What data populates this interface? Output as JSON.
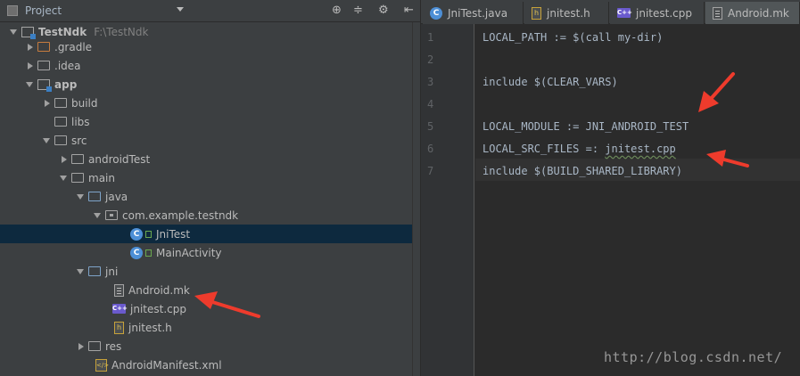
{
  "project_panel": {
    "title": "Project"
  },
  "tree": [
    {
      "label": "TestNdk",
      "path": "F:\\TestNdk"
    },
    {
      "label": ".gradle"
    },
    {
      "label": ".idea"
    },
    {
      "label": "app"
    },
    {
      "label": "build"
    },
    {
      "label": "libs"
    },
    {
      "label": "src"
    },
    {
      "label": "androidTest"
    },
    {
      "label": "main"
    },
    {
      "label": "java"
    },
    {
      "label": "com.example.testndk"
    },
    {
      "label": "JniTest",
      "badge": "C"
    },
    {
      "label": "MainActivity",
      "badge": "C"
    },
    {
      "label": "jni"
    },
    {
      "label": "Android.mk"
    },
    {
      "label": "jnitest.cpp",
      "badge": "C++"
    },
    {
      "label": "jnitest.h",
      "badge": "h"
    },
    {
      "label": "res"
    },
    {
      "label": "AndroidManifest.xml"
    }
  ],
  "tabs": [
    {
      "label": "JniTest.java",
      "badge": "C"
    },
    {
      "label": "jnitest.h",
      "badge": "h"
    },
    {
      "label": "jnitest.cpp",
      "badge": "C++"
    },
    {
      "label": "Android.mk"
    }
  ],
  "editor": {
    "lines": [
      {
        "num": "1",
        "text": "LOCAL_PATH := $(call my-dir)"
      },
      {
        "num": "2",
        "text": ""
      },
      {
        "num": "3",
        "text": "include $(CLEAR_VARS)"
      },
      {
        "num": "4",
        "text": ""
      },
      {
        "num": "5",
        "text": "LOCAL_MODULE := JNI_ANDROID_TEST"
      },
      {
        "num": "6",
        "text": "LOCAL_SRC_FILES =: ",
        "squiggly": "jnitest.cpp"
      },
      {
        "num": "7",
        "text": "include $(BUILD_SHARED_LIBRARY)"
      }
    ]
  },
  "watermark": "http://blog.csdn.net/",
  "colors": {
    "arrow": "#ee3b2c",
    "selection": "#0d293e",
    "panel_bg": "#3c3f41",
    "editor_bg": "#2b2b2b"
  }
}
